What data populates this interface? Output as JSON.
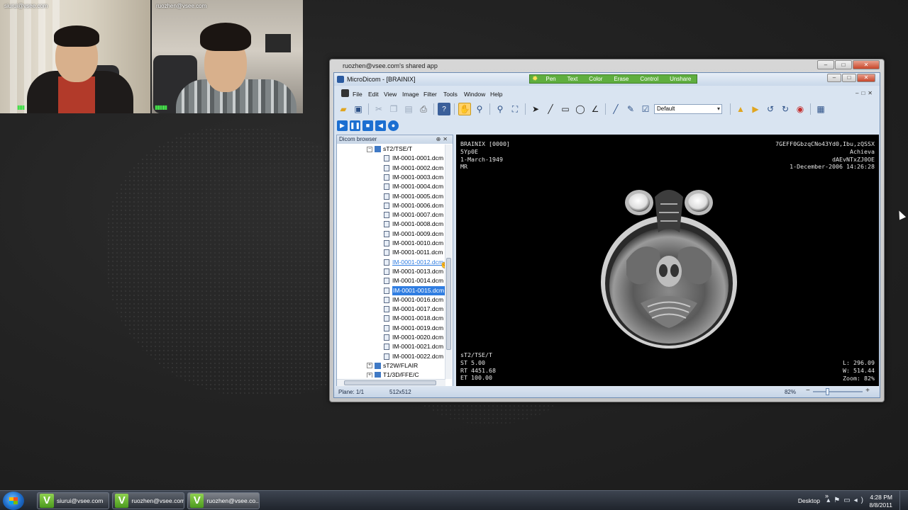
{
  "videos": [
    {
      "label": "siurui@vsee.com"
    },
    {
      "label": "ruozhen@vsee.com"
    }
  ],
  "outer_window": {
    "title": "ruozhen@vsee.com's shared app"
  },
  "app": {
    "title": "MicroDicom - [BRAINIX]",
    "share_tools": [
      "Pen",
      "Text",
      "Color",
      "Erase",
      "Control",
      "Unshare"
    ],
    "menu": [
      "File",
      "Edit",
      "View",
      "Image",
      "Filter",
      "Tools",
      "Window",
      "Help"
    ],
    "preset": "Default"
  },
  "browser": {
    "title": "Dicom browser",
    "series_open": "sT2/TSE/T",
    "files": [
      "IM-0001-0001.dcm",
      "IM-0001-0002.dcm",
      "IM-0001-0003.dcm",
      "IM-0001-0004.dcm",
      "IM-0001-0005.dcm",
      "IM-0001-0006.dcm",
      "IM-0001-0007.dcm",
      "IM-0001-0008.dcm",
      "IM-0001-0009.dcm",
      "IM-0001-0010.dcm",
      "IM-0001-0011.dcm",
      "IM-0001-0012.dcm",
      "IM-0001-0013.dcm",
      "IM-0001-0014.dcm",
      "IM-0001-0015.dcm",
      "IM-0001-0016.dcm",
      "IM-0001-0017.dcm",
      "IM-0001-0018.dcm",
      "IM-0001-0019.dcm",
      "IM-0001-0020.dcm",
      "IM-0001-0021.dcm",
      "IM-0001-0022.dcm"
    ],
    "hover_index": 11,
    "selected_index": 14,
    "series_closed": [
      "sT2W/FLAIR",
      "T1/3D/FFE/C"
    ]
  },
  "viewer": {
    "top_left": [
      "BRAINIX [0000]",
      "5Yp0E",
      "1-March-1949",
      "MR"
    ],
    "top_right": [
      "7GEFF0GbzqCNo43Yd0,Ibu,zQSSX",
      "Achieva",
      "dAEvNTxZJ0OE",
      "1-December-2006 14:26:28"
    ],
    "bottom_left": [
      "sT2/TSE/T",
      "ST 5.00",
      "RT 4451.68",
      "ET 100.00"
    ],
    "bottom_right": [
      "L: 296.09",
      "W: 514.44",
      "Zoom: 82%"
    ]
  },
  "status": {
    "plane": "Plane: 1/1",
    "size": "512x512",
    "zoom": "82%"
  },
  "taskbar": {
    "tasks": [
      {
        "label": "siurui@vsee.com"
      },
      {
        "label": "ruozhen@vsee.com"
      },
      {
        "label": "ruozhen@vsee.co..."
      }
    ],
    "desktop": "Desktop",
    "time": "4:28 PM",
    "date": "8/8/2011"
  }
}
